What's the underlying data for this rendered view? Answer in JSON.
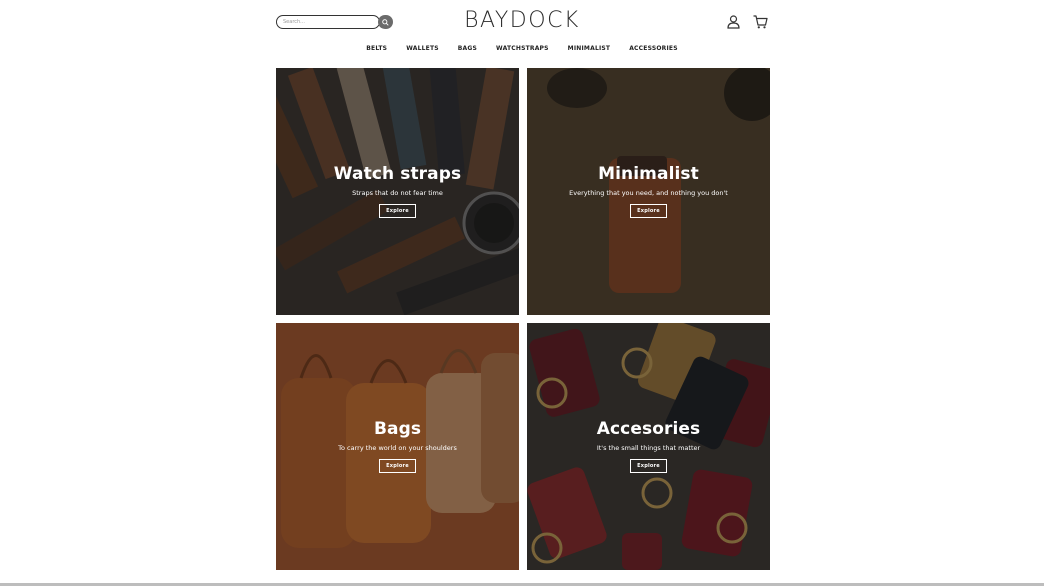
{
  "header": {
    "search_placeholder": "Search...",
    "logo": "BAYDOCK"
  },
  "nav": {
    "items": [
      "BELTS",
      "WALLETS",
      "BAGS",
      "WATCHSTRAPS",
      "MINIMALIST",
      "ACCESSORIES"
    ]
  },
  "tiles": [
    {
      "title": "Watch straps",
      "subtitle": "Straps that do not fear time",
      "button": "Explore"
    },
    {
      "title": "Minimalist",
      "subtitle": "Everything that you need, and nothing you don't",
      "button": "Explore"
    },
    {
      "title": "Bags",
      "subtitle": "To carry the world on your shoulders",
      "button": "Explore"
    },
    {
      "title": "Accesories",
      "subtitle": "It's the small things that matter",
      "button": "Explore"
    }
  ],
  "icons": {
    "search": "search-icon",
    "account": "user-icon",
    "cart": "cart-icon"
  },
  "colors": {
    "text_dark": "#222222",
    "search_button": "#6b6b6b"
  }
}
